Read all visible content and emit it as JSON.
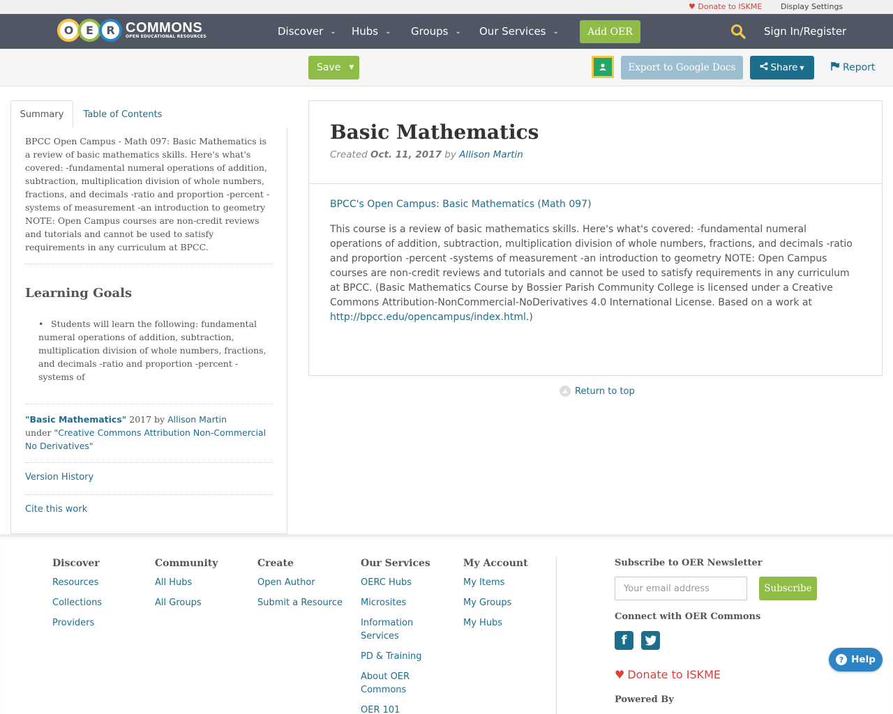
{
  "utility": {
    "donate": "Donate to ISKME",
    "display_settings": "Display Settings"
  },
  "logo": {
    "letters": [
      "O",
      "E",
      "R"
    ],
    "name": "COMMONS",
    "tagline": "OPEN EDUCATIONAL RESOURCES"
  },
  "nav": {
    "items": [
      {
        "label": "Discover"
      },
      {
        "label": "Hubs"
      },
      {
        "label": "Groups"
      },
      {
        "label": "Our Services"
      }
    ],
    "add_oer": "Add OER",
    "sign_in": "Sign In/Register"
  },
  "toolbar": {
    "save": "Save",
    "export": "Export to Google Docs",
    "share": "Share",
    "report": "Report"
  },
  "left": {
    "tabs": [
      "Summary",
      "Table of Contents"
    ],
    "summary": "BPCC Open Campus - Math 097: Basic Mathematics is a review of basic mathematics skills. Here's what's covered: -fundamental numeral operations of addition, subtraction, multiplication division of whole numbers, fractions, and decimals -ratio and proportion -percent -systems of measurement -an introduction to geometry NOTE: Open Campus courses are non-credit reviews and tutorials and cannot be used to satisfy requirements in any curriculum at BPCC.",
    "learning_goals_title": "Learning Goals",
    "learning_goals": [
      "Students will learn the following: fundamental numeral operations of addition, subtraction, multiplication division of whole numbers, fractions, and decimals -ratio and proportion -percent -systems of"
    ],
    "attribution": {
      "title": "\"Basic Mathematics\"",
      "year": "2017 by",
      "author": "Allison Martin",
      "under": "under",
      "license": "\"Creative Commons Attribution Non-Commercial No Derivatives\""
    },
    "version_history": "Version History",
    "cite": "Cite this work"
  },
  "main": {
    "title": "Basic Mathematics",
    "created_label": "Created",
    "created_date": "Oct. 11, 2017",
    "by": "by",
    "author": "Allison Martin",
    "link_title": "BPCC's Open Campus: Basic Mathematics (Math 097)",
    "description": "This course is a review of basic mathematics skills. Here's what's covered: -fundamental numeral operations of addition, subtraction, multiplication division of whole numbers, fractions, and decimals -ratio and proportion -percent -systems of measurement -an introduction to geometry NOTE: Open Campus courses are non-credit reviews and tutorials and cannot be used to satisfy requirements in any curriculum at BPCC. (Basic Mathematics Course by Bossier Parish Community College is licensed under a Creative Commons Attribution-NonCommercial-NoDerivatives 4.0 International License. Based on a work at",
    "description_link": "http://bpcc.edu/opencampus/index.html",
    "description_end": ".)",
    "return_top": "Return to top"
  },
  "footer": {
    "columns": [
      {
        "heading": "Discover",
        "links": [
          "Resources",
          "Collections",
          "Providers"
        ]
      },
      {
        "heading": "Community",
        "links": [
          "All Hubs",
          "All Groups"
        ]
      },
      {
        "heading": "Create",
        "links": [
          "Open Author",
          "Submit a Resource"
        ]
      },
      {
        "heading": "Our Services",
        "links": [
          "OERC Hubs",
          "Microsites",
          "Information Services",
          "PD & Training",
          "About OER Commons",
          "OER 101"
        ]
      },
      {
        "heading": "My Account",
        "links": [
          "My Items",
          "My Groups",
          "My Hubs"
        ]
      }
    ],
    "newsletter_heading": "Subscribe to OER Newsletter",
    "email_placeholder": "Your email address",
    "subscribe": "Subscribe",
    "connect_heading": "Connect with OER Commons",
    "donate": "Donate to ISKME",
    "powered_by": "Powered By"
  },
  "help": "Help",
  "colors": {
    "nav_bg": "#505663",
    "accent_green": "#8ebc46",
    "link_blue": "#1c6f8c",
    "donate_red": "#d9413a",
    "help_blue": "#2c84c4"
  }
}
